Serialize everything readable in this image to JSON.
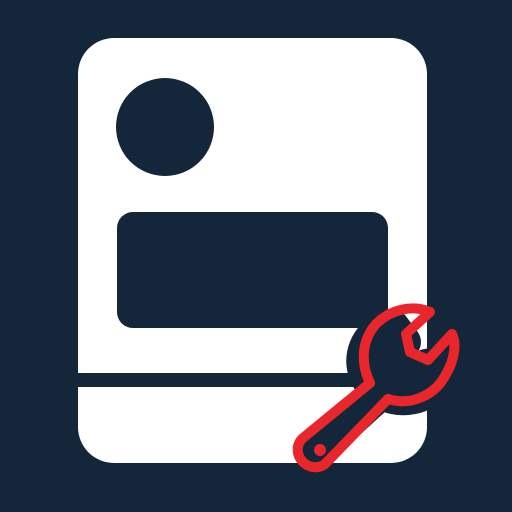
{
  "icon": {
    "name": "appliance-repair-icon",
    "colors": {
      "background": "#14263a",
      "body": "#ffffff",
      "accent": "#e8262b"
    }
  }
}
